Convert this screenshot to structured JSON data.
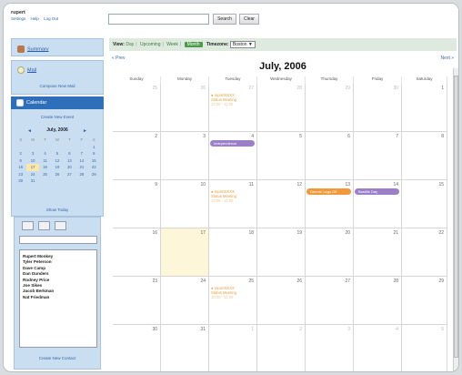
{
  "header": {
    "user": "rupert",
    "links": [
      "Settings",
      "Help",
      "Log Out"
    ],
    "search_button": "Search",
    "clear_button": "Clear"
  },
  "sidebar": {
    "summary": "Summary",
    "mail": "Mail",
    "compose": "Compose New Mail",
    "calendar": "Calendar",
    "create_event": "Create New Event",
    "show_today": "Show Today",
    "create_contact": "Create New Contact"
  },
  "mini_calendar": {
    "title": "July, 2006",
    "prev_arrow": "◄",
    "next_arrow": "►",
    "dow": [
      "S",
      "M",
      "T",
      "W",
      "T",
      "F",
      "S"
    ],
    "rows": [
      [
        "",
        "",
        "",
        "",
        "",
        "",
        "1"
      ],
      [
        "2",
        "3",
        "4",
        "5",
        "6",
        "7",
        "8"
      ],
      [
        "9",
        "10",
        "11",
        "12",
        "13",
        "14",
        "15"
      ],
      [
        "16",
        "17",
        "18",
        "19",
        "20",
        "21",
        "22"
      ],
      [
        "23",
        "24",
        "25",
        "26",
        "27",
        "28",
        "29"
      ],
      [
        "30",
        "31",
        "",
        "",
        "",
        "",
        ""
      ]
    ],
    "today": "17"
  },
  "contacts": [
    "Rupert Monkey",
    "Tyler Peterson",
    "Dave Camp",
    "Dan Dunders",
    "Rodney Price",
    "Joe Sikes",
    "Jacob Berkman",
    "Nat Friedman"
  ],
  "view": {
    "label": "View:",
    "options": [
      "Day",
      "Upcoming",
      "Week"
    ],
    "active": "Month",
    "tz_label": "Timezone:",
    "tz_value": "Boston"
  },
  "calendar": {
    "prev": "« Prev",
    "next": "Next »",
    "month_title": "July, 2006",
    "weekdays": [
      "Sunday",
      "Monday",
      "Tuesday",
      "Wednesday",
      "Thursday",
      "Friday",
      "Saturday"
    ],
    "weeks": [
      [
        "25",
        "26",
        "27",
        "28",
        "29",
        "30",
        "1"
      ],
      [
        "2",
        "3",
        "4",
        "5",
        "6",
        "7",
        "8"
      ],
      [
        "9",
        "10",
        "11",
        "12",
        "13",
        "14",
        "15"
      ],
      [
        "16",
        "17",
        "18",
        "19",
        "20",
        "21",
        "22"
      ],
      [
        "23",
        "24",
        "25",
        "26",
        "27",
        "28",
        "29"
      ],
      [
        "30",
        "31",
        "1",
        "2",
        "3",
        "4",
        "5"
      ]
    ],
    "events": {
      "w0_tue": [
        "● reportXXXX",
        "Status Meeting",
        "10:00 - 11:00"
      ],
      "w1_tue": "Independence",
      "w2_tue": [
        "● reportXXXX",
        "Status Meeting",
        "10:00 - 11:00"
      ],
      "w2_thu": "Dennis' Legs Off",
      "w2_fri": "Bastille Day",
      "w4_tue": [
        "● reportXXXX",
        "Status Meeting",
        "10:00 - 11:00"
      ]
    },
    "colors": {
      "pill_purple": "#9b7fc9",
      "pill_orange": "#f0993a",
      "event_text": "#e5a13a"
    }
  }
}
